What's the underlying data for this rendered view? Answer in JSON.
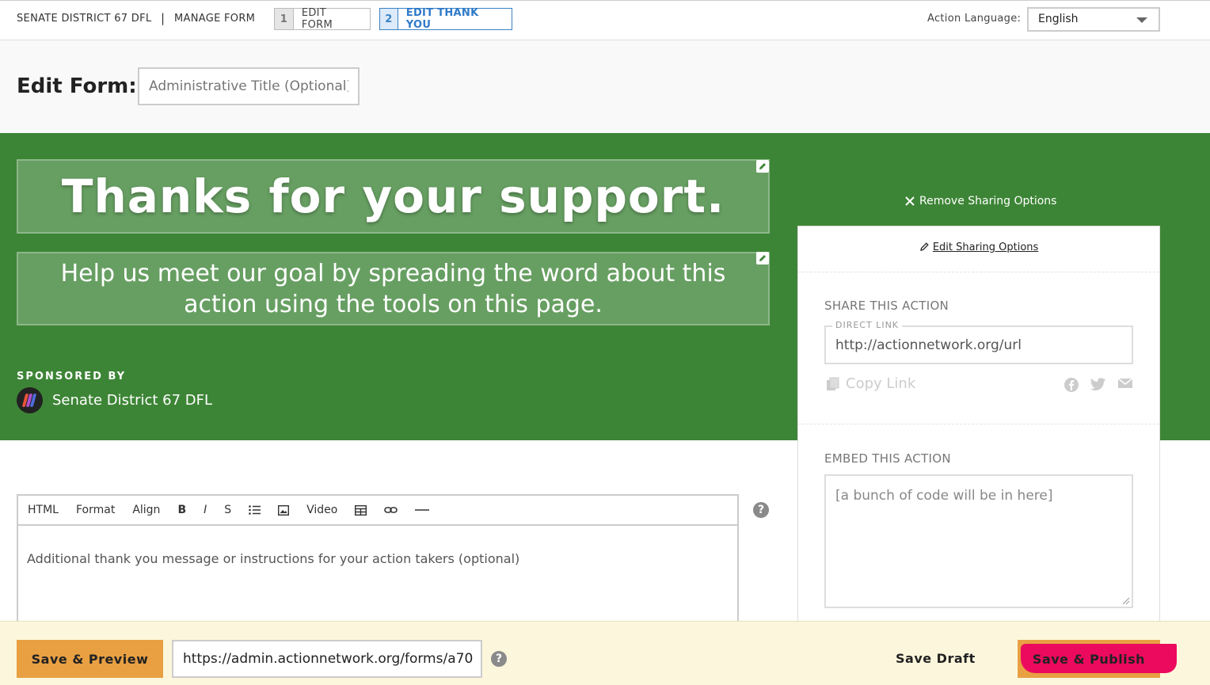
{
  "topbar": {
    "org_name": "SENATE DISTRICT 67 DFL",
    "separator": "|",
    "manage_form": "MANAGE FORM",
    "steps": [
      {
        "num": "1",
        "label": "EDIT FORM"
      },
      {
        "num": "2",
        "label": "EDIT THANK YOU"
      }
    ],
    "active_step": "2",
    "language_label": "Action Language:",
    "language_value": "English"
  },
  "header": {
    "title": "Edit Form:",
    "admin_title_placeholder": "Administrative Title (Optional)"
  },
  "hero": {
    "background_color": "#3d8536",
    "headline": "Thanks for your support.",
    "subheadline": "Help us meet our goal by spreading the word about this action using the tools on this page.",
    "sponsored_by_label": "SPONSORED BY",
    "sponsor_name": "Senate District 67 DFL",
    "remove_sharing": "Remove Sharing Options"
  },
  "sharing": {
    "edit_link": "Edit Sharing Options",
    "share_title": "SHARE THIS ACTION",
    "direct_link_label": "DIRECT LINK",
    "direct_link_value": "http://actionnetwork.org/url",
    "copy_link": "Copy Link",
    "social": [
      "facebook-icon",
      "twitter-icon",
      "email-icon"
    ],
    "embed_title": "EMBED THIS ACTION",
    "embed_placeholder": "[a bunch of code will be in here]"
  },
  "editor": {
    "toolbar": {
      "html": "HTML",
      "format": "Format",
      "align": "Align",
      "bold": "B",
      "italic": "I",
      "strike": "S",
      "video": "Video"
    },
    "placeholder": "Additional thank you message or instructions for your action takers (optional)"
  },
  "bottombar": {
    "save_preview": "Save & Preview",
    "url_value": "https://admin.actionnetwork.org/forms/a70",
    "save_draft": "Save Draft",
    "save_publish": "Save & Publish",
    "accent_color": "#e8a043",
    "highlight_color": "#ec0a5e"
  }
}
